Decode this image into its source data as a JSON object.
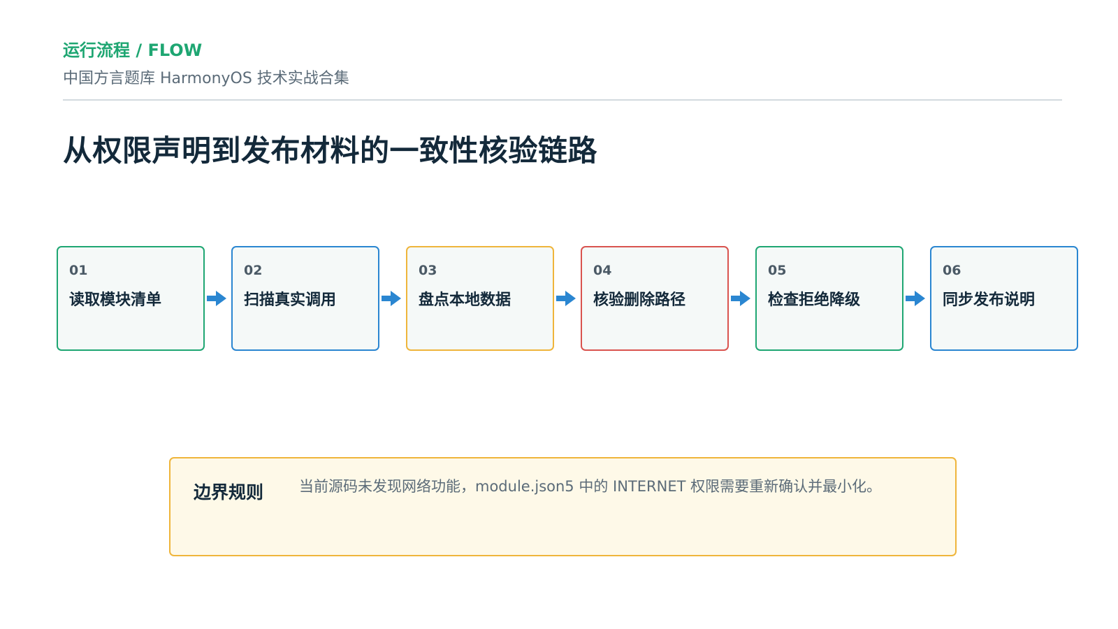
{
  "header": {
    "kicker": "运行流程 / FLOW",
    "subtitle": "中国方言题库 HarmonyOS 技术实战合集",
    "title": "从权限声明到发布材料的一致性核验链路"
  },
  "steps": [
    {
      "num": "01",
      "label": "读取模块清单",
      "color": "#1ea672"
    },
    {
      "num": "02",
      "label": "扫描真实调用",
      "color": "#2a86d1"
    },
    {
      "num": "03",
      "label": "盘点本地数据",
      "color": "#efb53b"
    },
    {
      "num": "04",
      "label": "核验删除路径",
      "color": "#d9534f"
    },
    {
      "num": "05",
      "label": "检查拒绝降级",
      "color": "#1ea672"
    },
    {
      "num": "06",
      "label": "同步发布说明",
      "color": "#2a86d1"
    }
  ],
  "arrow_color": "#2a86d1",
  "note": {
    "tag": "边界规则",
    "text": "当前源码未发现网络功能，module.json5 中的 INTERNET 权限需要重新确认并最小化。"
  }
}
